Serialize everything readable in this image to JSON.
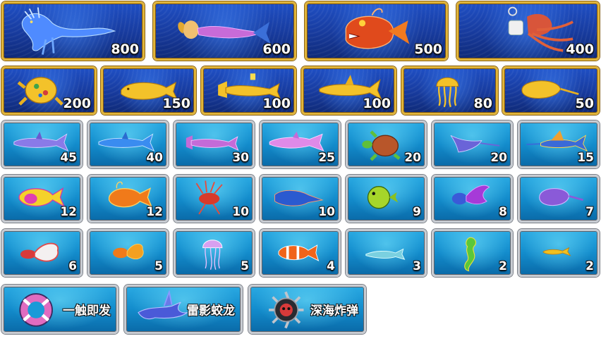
{
  "colors": {
    "gold_border": "#e0b43a",
    "silver_border": "#c8ccd2",
    "gold_bg": "#173a9c",
    "silver_bg": "#138ccc",
    "value_text": "#ffffff"
  },
  "big_fish": [
    {
      "name": "dragon-fish",
      "value": "800",
      "icon": "blue-dragon-icon"
    },
    {
      "name": "mermaid",
      "value": "600",
      "icon": "mermaid-icon"
    },
    {
      "name": "red-anglerfish",
      "value": "500",
      "icon": "red-anglerfish-icon"
    },
    {
      "name": "squid-rider",
      "value": "400",
      "icon": "squid-icon"
    }
  ],
  "golden_fish": [
    {
      "name": "golden-turtle",
      "value": "200",
      "icon": "golden-turtle-icon"
    },
    {
      "name": "golden-whale",
      "value": "150",
      "icon": "golden-whale-icon"
    },
    {
      "name": "golden-hammerhead",
      "value": "100",
      "icon": "golden-hammerhead-icon"
    },
    {
      "name": "golden-shark",
      "value": "100",
      "icon": "golden-shark-icon"
    },
    {
      "name": "golden-jellyfish",
      "value": "80",
      "icon": "golden-jellyfish-icon"
    },
    {
      "name": "golden-horseshoe-crab",
      "value": "50",
      "icon": "golden-horseshoe-crab-icon"
    }
  ],
  "row3": [
    {
      "name": "purple-shark",
      "value": "45",
      "icon": "shark-icon"
    },
    {
      "name": "blue-shark",
      "value": "40",
      "icon": "shark-icon"
    },
    {
      "name": "hammerhead",
      "value": "30",
      "icon": "hammerhead-icon"
    },
    {
      "name": "dolphin",
      "value": "25",
      "icon": "dolphin-icon"
    },
    {
      "name": "sea-turtle",
      "value": "20",
      "icon": "turtle-icon"
    },
    {
      "name": "manta-ray",
      "value": "20",
      "icon": "manta-ray-icon"
    },
    {
      "name": "swordfish",
      "value": "15",
      "icon": "swordfish-icon"
    }
  ],
  "row4": [
    {
      "name": "parrotfish",
      "value": "12",
      "icon": "parrotfish-icon"
    },
    {
      "name": "anglerfish",
      "value": "12",
      "icon": "anglerfish-icon"
    },
    {
      "name": "lionfish",
      "value": "10",
      "icon": "lionfish-icon"
    },
    {
      "name": "sawfish",
      "value": "10",
      "icon": "sawfish-icon"
    },
    {
      "name": "pufferfish",
      "value": "9",
      "icon": "pufferfish-icon"
    },
    {
      "name": "lionhead-fish",
      "value": "8",
      "icon": "fancy-fish-icon"
    },
    {
      "name": "horseshoe-crab",
      "value": "7",
      "icon": "horseshoe-crab-icon"
    }
  ],
  "row5": [
    {
      "name": "betta-fish",
      "value": "6",
      "icon": "betta-icon"
    },
    {
      "name": "goldfish",
      "value": "5",
      "icon": "goldfish-icon"
    },
    {
      "name": "jellyfish",
      "value": "5",
      "icon": "jellyfish-icon"
    },
    {
      "name": "clownfish",
      "value": "4",
      "icon": "clownfish-icon"
    },
    {
      "name": "small-shark",
      "value": "3",
      "icon": "small-shark-icon"
    },
    {
      "name": "seahorse",
      "value": "2",
      "icon": "seahorse-icon"
    },
    {
      "name": "small-fish",
      "value": "2",
      "icon": "small-fish-icon"
    }
  ],
  "specials": [
    {
      "name": "one-touch-trigger",
      "label": "一触即发",
      "icon": "lifebuoy-icon"
    },
    {
      "name": "thunder-dragon",
      "label": "雷影蛟龙",
      "icon": "thunder-dragon-icon"
    },
    {
      "name": "deep-sea-bomb",
      "label": "深海炸弹",
      "icon": "skull-bomb-icon"
    }
  ]
}
